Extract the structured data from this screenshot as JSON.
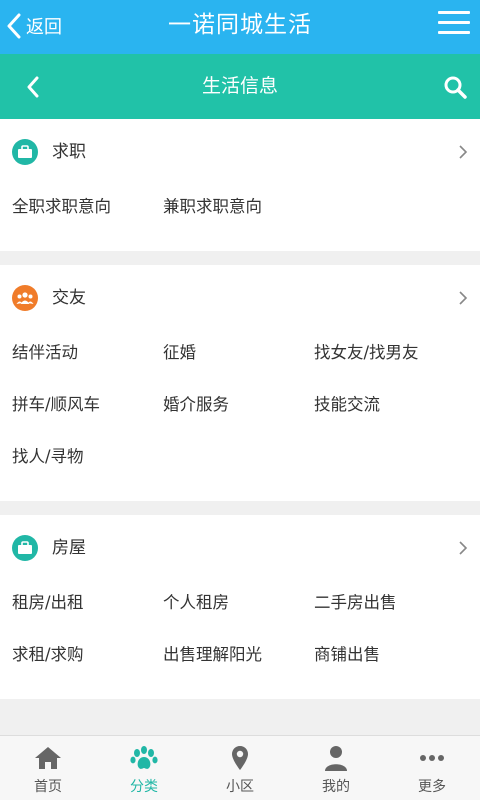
{
  "topbar": {
    "back_label": "返回",
    "title": "一诺同城生活"
  },
  "subbar": {
    "title": "生活信息"
  },
  "sections": [
    {
      "title": "求职",
      "icon": "briefcase-icon",
      "icon_color": "#21b7a6",
      "links": [
        "全职求职意向",
        "兼职求职意向"
      ]
    },
    {
      "title": "交友",
      "icon": "group-icon",
      "icon_color": "#f07c2a",
      "links": [
        "结伴活动",
        "征婚",
        "找女友/找男友",
        "拼车/顺风车",
        "婚介服务",
        "技能交流",
        "找人/寻物"
      ]
    },
    {
      "title": "房屋",
      "icon": "briefcase-icon",
      "icon_color": "#21b7a6",
      "links": [
        "租房/出租",
        "个人租房",
        "二手房出售",
        "求租/求购",
        "出售理解阳光",
        "商铺出售"
      ]
    }
  ],
  "tabbar": {
    "items": [
      {
        "label": "首页",
        "icon": "home-icon"
      },
      {
        "label": "分类",
        "icon": "paw-icon",
        "active": true
      },
      {
        "label": "小区",
        "icon": "location-pin-icon"
      },
      {
        "label": "我的",
        "icon": "user-icon"
      },
      {
        "label": "更多",
        "icon": "more-dots-icon"
      }
    ]
  },
  "colors": {
    "topbar": "#2ab4f0",
    "subbar": "#21c2a8",
    "accent": "#21b7a6",
    "orange": "#f07c2a"
  }
}
